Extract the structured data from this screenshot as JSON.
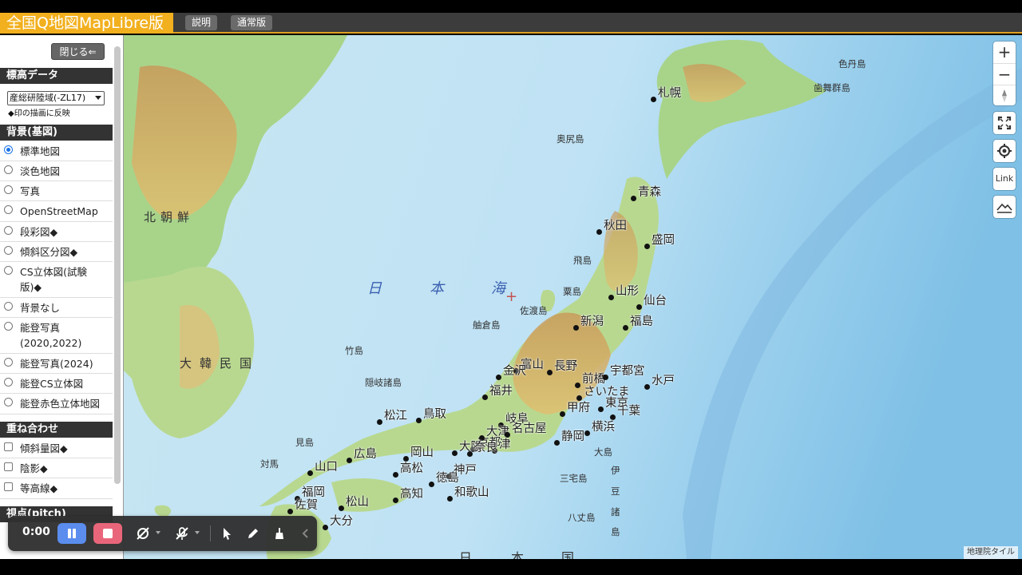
{
  "app": {
    "title": "全国Q地図MapLibre版",
    "tabs": [
      "説明",
      "通常版"
    ]
  },
  "sidebar": {
    "close_label": "閉じる⇐",
    "elevation": {
      "header": "標高データ",
      "selected": "産総研陸域(-ZL17)",
      "note": "◆印の描画に反映"
    },
    "background": {
      "header": "背景(基図)",
      "options": [
        {
          "label": "標準地図",
          "selected": true
        },
        {
          "label": "淡色地図",
          "selected": false
        },
        {
          "label": "写真",
          "selected": false
        },
        {
          "label": "OpenStreetMap",
          "selected": false
        },
        {
          "label": "段彩図◆",
          "selected": false
        },
        {
          "label": "傾斜区分図◆",
          "selected": false
        },
        {
          "label": "CS立体図(試験版)◆",
          "selected": false
        },
        {
          "label": "背景なし",
          "selected": false
        },
        {
          "label": "能登写真(2020,2022)",
          "selected": false
        },
        {
          "label": "能登写真(2024)",
          "selected": false
        },
        {
          "label": "能登CS立体図",
          "selected": false
        },
        {
          "label": "能登赤色立体地図",
          "selected": false
        }
      ]
    },
    "overlay": {
      "header": "重ね合わせ",
      "options": [
        {
          "label": "傾斜量図◆",
          "checked": false
        },
        {
          "label": "陰影◆",
          "checked": false
        },
        {
          "label": "等高線◆",
          "checked": false
        }
      ]
    },
    "pitch_header": "視点(pitch)"
  },
  "map": {
    "seas": [
      "日",
      "本",
      "海"
    ],
    "bottom_sea": [
      "日",
      "本",
      "国"
    ],
    "countries": [
      "北朝鮮",
      "大韓民国"
    ],
    "islands": [
      "色丹島",
      "歯舞群島",
      "奥尻島",
      "飛島",
      "粟島",
      "佐渡島",
      "舳倉島",
      "竹島",
      "隠岐諸島",
      "見島",
      "対馬",
      "大島",
      "伊",
      "豆",
      "諸",
      "島",
      "三宅島",
      "八丈島"
    ],
    "cities": [
      "札幌",
      "青森",
      "秋田",
      "盛岡",
      "山形",
      "仙台",
      "新潟",
      "福島",
      "富山",
      "長野",
      "金沢",
      "前橋",
      "宇都宮",
      "水戸",
      "福井",
      "さいたま",
      "東京",
      "千葉",
      "松江",
      "鳥取",
      "岐阜",
      "甲府",
      "京都",
      "大津",
      "名古屋",
      "横浜",
      "山口",
      "広島",
      "岡山",
      "大阪",
      "津",
      "静岡",
      "神戸",
      "奈良",
      "高松",
      "徳島",
      "和歌山",
      "福岡",
      "佐賀",
      "松山",
      "高知",
      "大分"
    ]
  },
  "controls": {
    "zoom_in": "+",
    "zoom_out": "−",
    "link_label": "Link"
  },
  "attribution": "地理院タイル",
  "recorder": {
    "time": "0:00"
  }
}
